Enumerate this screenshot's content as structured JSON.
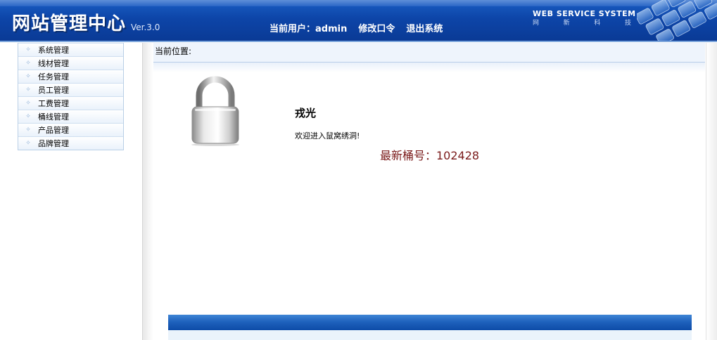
{
  "header": {
    "title": "网站管理中心",
    "version": "Ver.3.0",
    "current_user_label": "当前用户：admin",
    "change_password": "修改口令",
    "logout": "退出系统",
    "brand_en": "WEB SERVICE SYSTEM",
    "brand_cn": [
      "网",
      "新",
      "科",
      "技"
    ]
  },
  "sidebar": {
    "items": [
      {
        "label": "系统管理"
      },
      {
        "label": "线材管理"
      },
      {
        "label": "任务管理"
      },
      {
        "label": "员工管理"
      },
      {
        "label": "工费管理"
      },
      {
        "label": "桶线管理"
      },
      {
        "label": "产品管理"
      },
      {
        "label": "品牌管理"
      }
    ]
  },
  "main": {
    "location_label": "当前位置:",
    "welcome_name": "戎光",
    "welcome_message": "欢迎进入鼠窝绣洞!",
    "latest_bucket": "最新桶号：102428"
  },
  "colors": {
    "header_blue": "#0d45a8",
    "latest_text": "#7a1a1a",
    "sidebar_border": "#b9cfe6"
  },
  "icons": [
    "lock-icon",
    "bullet-icon",
    "keyboard-decoration"
  ]
}
